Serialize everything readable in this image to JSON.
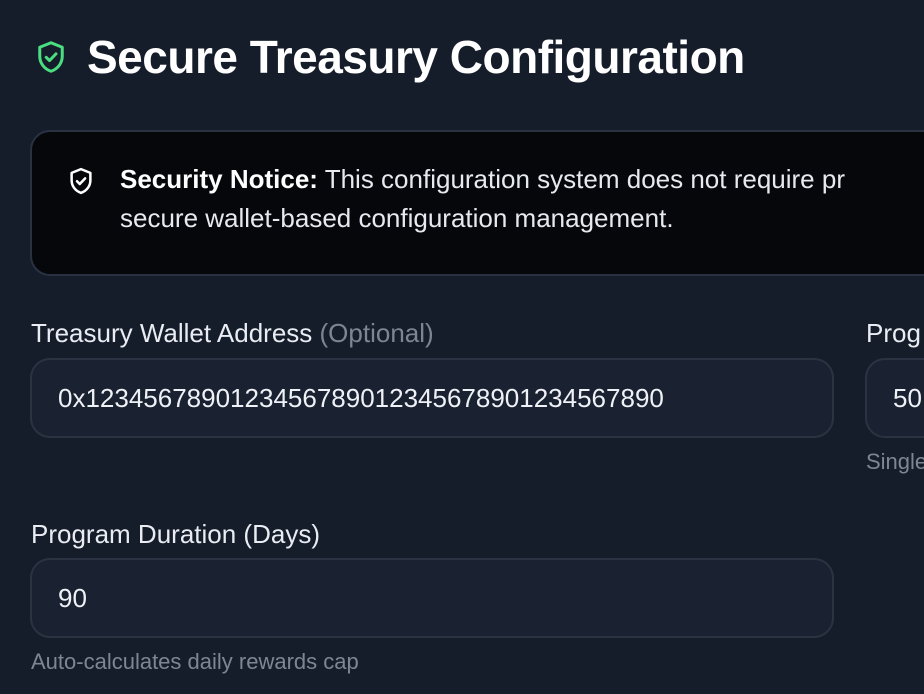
{
  "header": {
    "title": "Secure Treasury Configuration"
  },
  "notice": {
    "strong_label": "Security Notice:",
    "line1": "This configuration system does not require pr",
    "line2": "secure wallet-based configuration management."
  },
  "fields": {
    "wallet": {
      "label": "Treasury Wallet Address",
      "optional": "(Optional)",
      "value": "0x1234567890123456789012345678901234567890"
    },
    "program_right": {
      "label": "Prog",
      "value": "50",
      "hint": "Single"
    },
    "duration": {
      "label": "Program Duration (Days)",
      "value": "90",
      "hint": "Auto-calculates daily rewards cap"
    }
  },
  "colors": {
    "background": "#161d2a",
    "accent_shield": "#4ade80",
    "notice_background": "#05070b",
    "input_background": "#1a2130",
    "muted_text": "#7e8695"
  },
  "icons": {
    "title": "shield-check-icon",
    "notice": "shield-check-icon"
  }
}
